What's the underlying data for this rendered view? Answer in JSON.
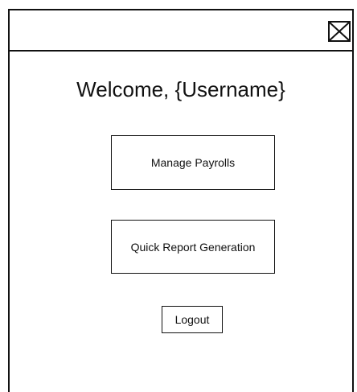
{
  "window": {
    "close_icon": "close-box-icon"
  },
  "main": {
    "welcome_text": "Welcome, {Username}",
    "manage_payrolls_label": "Manage Payrolls",
    "quick_report_label": "Quick Report Generation",
    "logout_label": "Logout"
  },
  "colors": {
    "stroke": "#111111",
    "background": "#ffffff"
  }
}
